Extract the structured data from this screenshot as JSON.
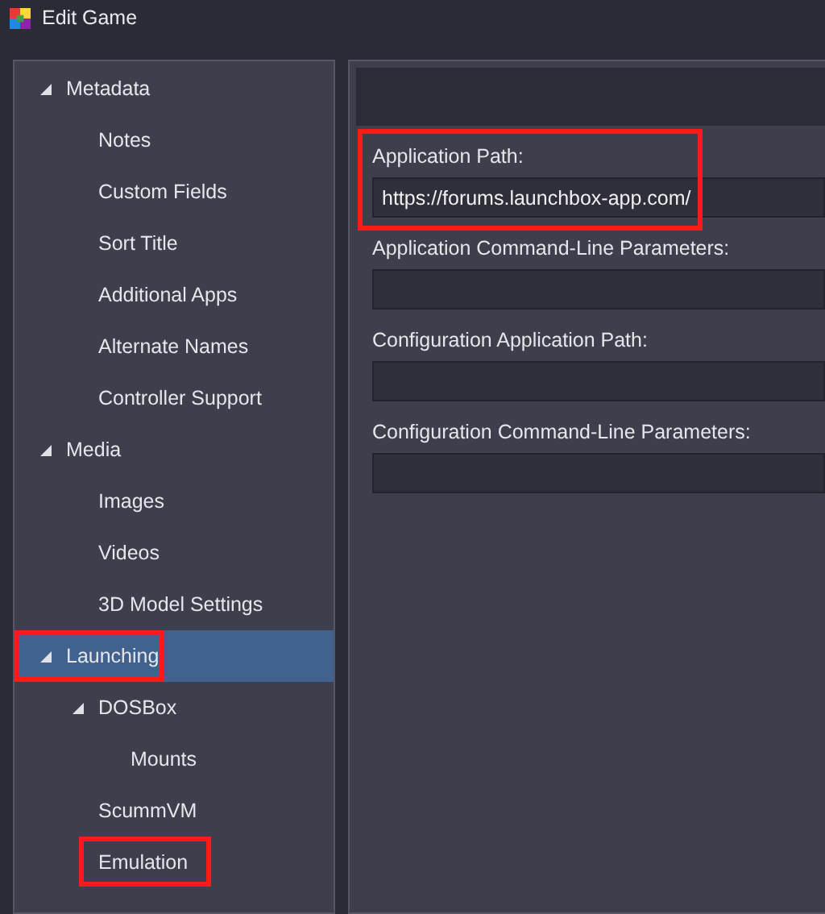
{
  "window": {
    "title": "Edit Game"
  },
  "tree": [
    {
      "label": "Metadata",
      "expanded": true,
      "selected": false,
      "highlighted": false,
      "children": [
        {
          "label": "Notes",
          "selected": false,
          "highlighted": false
        },
        {
          "label": "Custom Fields",
          "selected": false,
          "highlighted": false
        },
        {
          "label": "Sort Title",
          "selected": false,
          "highlighted": false
        },
        {
          "label": "Additional Apps",
          "selected": false,
          "highlighted": false
        },
        {
          "label": "Alternate Names",
          "selected": false,
          "highlighted": false
        },
        {
          "label": "Controller Support",
          "selected": false,
          "highlighted": false
        }
      ]
    },
    {
      "label": "Media",
      "expanded": true,
      "selected": false,
      "highlighted": false,
      "children": [
        {
          "label": "Images",
          "selected": false,
          "highlighted": false
        },
        {
          "label": "Videos",
          "selected": false,
          "highlighted": false
        },
        {
          "label": "3D Model Settings",
          "selected": false,
          "highlighted": false
        }
      ]
    },
    {
      "label": "Launching",
      "expanded": true,
      "selected": true,
      "highlighted": true,
      "children": [
        {
          "label": "DOSBox",
          "expanded": true,
          "selected": false,
          "highlighted": false,
          "children": [
            {
              "label": "Mounts",
              "selected": false,
              "highlighted": false
            }
          ]
        },
        {
          "label": "ScummVM",
          "selected": false,
          "highlighted": false
        },
        {
          "label": "Emulation",
          "selected": false,
          "highlighted": true
        }
      ]
    }
  ],
  "fields": [
    {
      "label": "Application Path:",
      "value": "https://forums.launchbox-app.com/",
      "highlighted": true
    },
    {
      "label": "Application Command-Line Parameters:",
      "highlighted": false
    },
    {
      "label": "Configuration Application Path:",
      "highlighted": false
    },
    {
      "label": "Configuration Command-Line Parameters:",
      "highlighted": false
    }
  ]
}
